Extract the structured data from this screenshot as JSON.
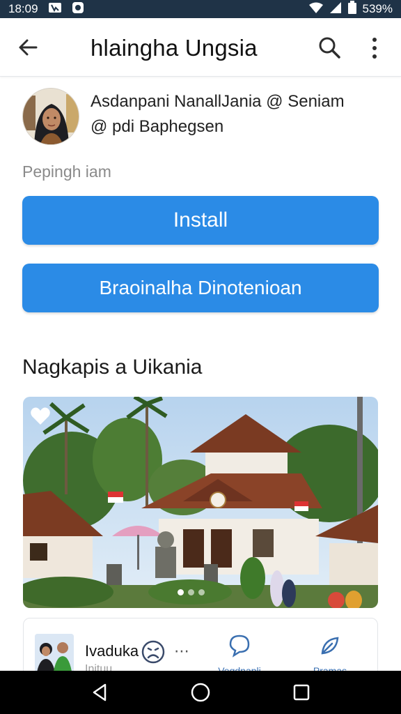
{
  "status_bar": {
    "time": "18:09",
    "battery_text": "539%"
  },
  "app_bar": {
    "title": "hlaingha Ungsia"
  },
  "developer": {
    "line1": "Asdanpani NanallJania @ Seniam",
    "line2": "@ pdi Baphegsen"
  },
  "meta_label": "Pepingh iam",
  "buttons": {
    "install": "Install",
    "secondary": "Braoinalha Dinotenioan"
  },
  "section": {
    "title": "Nagkapis a Uikania"
  },
  "gallery": {
    "dots": 3,
    "active_dot": 1
  },
  "card": {
    "title": "Ivaduka",
    "subtitle": "Inituu",
    "actions": [
      {
        "label": "Vegdnapli",
        "icon": "chat-bubble-icon"
      },
      {
        "label": "Pramas",
        "icon": "share-leaf-icon"
      }
    ]
  },
  "colors": {
    "accent": "#2b8be6",
    "status_bar": "#1f3347",
    "nav_bar": "#000000"
  }
}
